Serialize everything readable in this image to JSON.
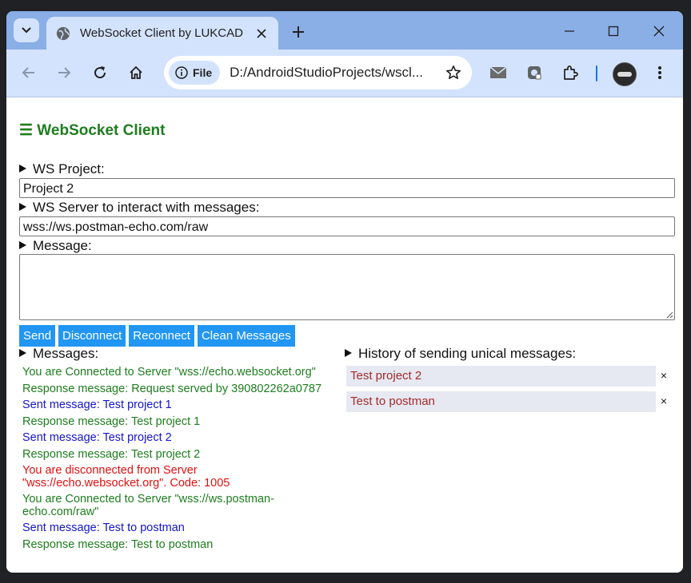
{
  "browser": {
    "tab_title": "WebSocket Client by LUKCAD",
    "url_chip": "File",
    "url": "D:/AndroidStudioProjects/wscl..."
  },
  "app": {
    "title": "☰ WebSocket Client",
    "project_label": "WS Project:",
    "project_value": "Project 2",
    "server_label": "WS Server to interact with messages:",
    "server_value": "wss://ws.postman-echo.com/raw",
    "message_label": "Message:",
    "message_value": "",
    "buttons": {
      "send": "Send",
      "disconnect": "Disconnect",
      "reconnect": "Reconnect",
      "clean": "Clean Messages"
    },
    "messages_label": "Messages:",
    "history_label": "History of sending unical messages:",
    "history": [
      {
        "text": "Test project 2",
        "remove": "×"
      },
      {
        "text": "Test to postman",
        "remove": "×"
      }
    ],
    "messages": [
      {
        "text": "You are Connected to Server \"wss://echo.websocket.org\"",
        "type": "connected"
      },
      {
        "text": "Response message: Request served by 390802262a0787",
        "type": "response"
      },
      {
        "text": "Sent message: Test project 1",
        "type": "sent"
      },
      {
        "text": "Response message: Test project 1",
        "type": "response"
      },
      {
        "text": "Sent message: Test project 2",
        "type": "sent"
      },
      {
        "text": "Response message: Test project 2",
        "type": "response"
      },
      {
        "text": "You are disconnected from Server \"wss://echo.websocket.org\". Code: 1005",
        "type": "disconnected"
      },
      {
        "text": "You are Connected to Server \"wss://ws.postman-echo.com/raw\"",
        "type": "connected"
      },
      {
        "text": "Sent message: Test to postman",
        "type": "sent"
      },
      {
        "text": "Response message: Test to postman",
        "type": "response"
      }
    ]
  },
  "colors": {
    "connected": "#1e7d1e",
    "response": "#1e7d1e",
    "sent": "#1515c8",
    "disconnected": "#e01010",
    "button": "#2196f3",
    "title": "#1e7d1e"
  }
}
